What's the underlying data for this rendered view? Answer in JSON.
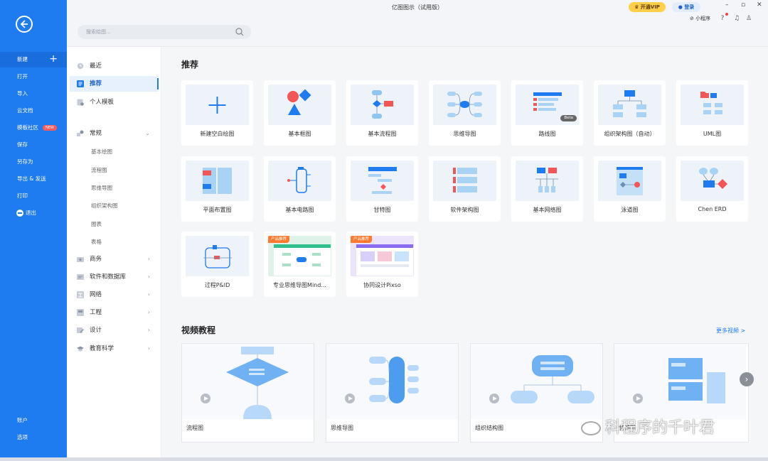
{
  "window": {
    "title": "亿图图示（试用版）",
    "vip_label": "开通VIP",
    "login_label": "登录",
    "mini_program_label": "小程序",
    "controls": [
      "–",
      "▫",
      "✕"
    ]
  },
  "search": {
    "placeholder": "搜索绘图..."
  },
  "leftbar": {
    "items": [
      {
        "label": "新建"
      },
      {
        "label": "打开"
      },
      {
        "label": "导入"
      },
      {
        "label": "云文档"
      },
      {
        "label": "模板社区",
        "badge": "NEW"
      },
      {
        "label": "保存"
      },
      {
        "label": "另存为"
      },
      {
        "label": "导出 & 发送"
      },
      {
        "label": "打印"
      },
      {
        "label": "退出"
      }
    ],
    "bottom": [
      {
        "label": "账户"
      },
      {
        "label": "选项"
      }
    ]
  },
  "categories": {
    "top": [
      {
        "label": "最近"
      },
      {
        "label": "推荐"
      },
      {
        "label": "个人模板"
      }
    ],
    "general": {
      "label": "常规",
      "sub": [
        "基本绘图",
        "流程图",
        "思维导图",
        "组织架构图",
        "图表",
        "表格"
      ]
    },
    "rest": [
      {
        "label": "商务"
      },
      {
        "label": "软件和数据库"
      },
      {
        "label": "网络"
      },
      {
        "label": "工程"
      },
      {
        "label": "设计"
      },
      {
        "label": "教育科学"
      }
    ]
  },
  "recommend": {
    "title": "推荐",
    "tiles": [
      {
        "label": "新建空白绘图"
      },
      {
        "label": "基本框图"
      },
      {
        "label": "基本流程图"
      },
      {
        "label": "思维导图"
      },
      {
        "label": "路线图",
        "badge": "Beta"
      },
      {
        "label": "组织架构图（自动）"
      },
      {
        "label": "UML图"
      },
      {
        "label": "平面布置图"
      },
      {
        "label": "基本电路图"
      },
      {
        "label": "甘特图"
      },
      {
        "label": "软件架构图"
      },
      {
        "label": "基本网络图"
      },
      {
        "label": "泳道图"
      },
      {
        "label": "Chen ERD"
      },
      {
        "label": "过程P&ID"
      },
      {
        "label": "专业思维导图Mind...",
        "badge": "产品推荐"
      },
      {
        "label": "协同设计Pixso",
        "badge": "产品推荐"
      }
    ]
  },
  "videos": {
    "title": "视频教程",
    "more_label": "更多视频 >",
    "items": [
      {
        "label": "流程图"
      },
      {
        "label": "思维导图"
      },
      {
        "label": "组织结构图"
      },
      {
        "label": "甘特图"
      }
    ]
  },
  "watermark": "科程序的千叶君",
  "colors": {
    "accent": "#1f7bf0",
    "vip": "#ffcf4a",
    "tile_icon_red": "#f25656",
    "tile_icon_blue": "#1f7bf0"
  }
}
